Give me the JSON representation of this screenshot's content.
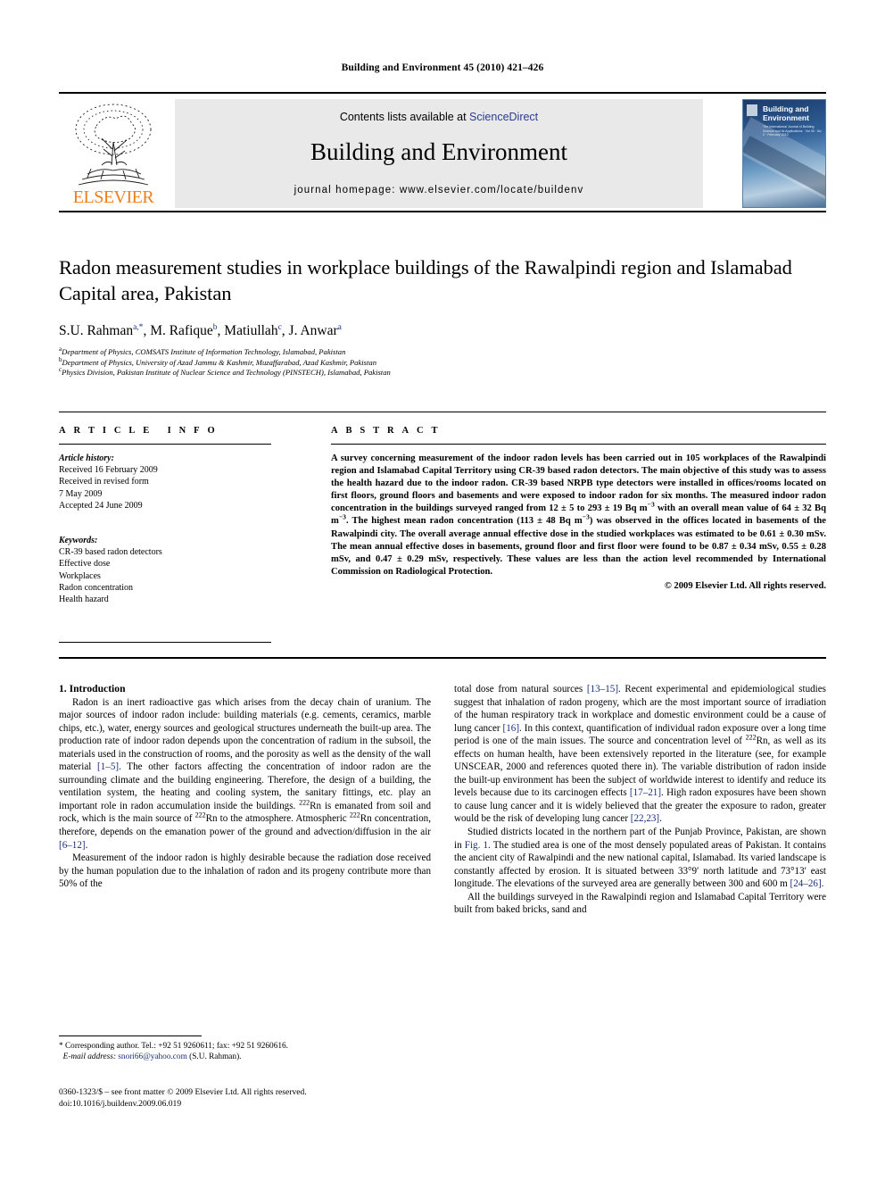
{
  "running_head": "Building and Environment 45 (2010) 421–426",
  "masthead": {
    "publisher_name": "ELSEVIER",
    "contents_prefix": "Contents lists available at ",
    "sciencedirect": "ScienceDirect",
    "journal_title": "Building and Environment",
    "homepage": "journal homepage: www.elsevier.com/locate/buildenv",
    "cover": {
      "title_line1": "Building and",
      "title_line2": "Environment",
      "subtitle": "The International Journal of Building Science and its Applications  ·  Vol 45  ·  No 2  ·  February 2010"
    }
  },
  "article": {
    "title": "Radon measurement studies in workplace buildings of the Rawalpindi region and Islamabad Capital area, Pakistan",
    "authors": "S.U. Rahman, M. Rafique, Matiullah, J. Anwar",
    "author_list": [
      {
        "name": "S.U. Rahman",
        "marks": "a,*"
      },
      {
        "name": "M. Rafique",
        "marks": "b"
      },
      {
        "name": "Matiullah",
        "marks": "c"
      },
      {
        "name": "J. Anwar",
        "marks": "a"
      }
    ],
    "affiliations": [
      {
        "mark": "a",
        "text": "Department of Physics, COMSATS Institute of Information Technology, Islamabad, Pakistan"
      },
      {
        "mark": "b",
        "text": "Department of Physics, University of Azad Jammu & Kashmir, Muzaffarabad, Azad Kashmir, Pakistan"
      },
      {
        "mark": "c",
        "text": "Physics Division, Pakistan Institute of Nuclear Science and Technology (PINSTECH), Islamabad, Pakistan"
      }
    ]
  },
  "article_info": {
    "heading": "ARTICLE INFO",
    "history_label": "Article history:",
    "history": [
      "Received 16 February 2009",
      "Received in revised form",
      "7 May 2009",
      "Accepted 24 June 2009"
    ],
    "keywords_label": "Keywords:",
    "keywords": [
      "CR-39 based radon detectors",
      "Effective dose",
      "Workplaces",
      "Radon concentration",
      "Health hazard"
    ]
  },
  "abstract": {
    "heading": "ABSTRACT",
    "text": "A survey concerning measurement of the indoor radon levels has been carried out in 105 workplaces of the Rawalpindi region and Islamabad Capital Territory using CR-39 based radon detectors. The main objective of this study was to assess the health hazard due to the indoor radon. CR-39 based NRPB type detectors were installed in offices/rooms located on first floors, ground floors and basements and were exposed to indoor radon for six months. The measured indoor radon concentration in the buildings surveyed ranged from 12 ± 5 to 293 ± 19 Bq m−3 with an overall mean value of 64 ± 32 Bq m−3. The highest mean radon concentration (113 ± 48 Bq m−3) was observed in the offices located in basements of the Rawalpindi city. The overall average annual effective dose in the studied workplaces was estimated to be 0.61 ± 0.30 mSv. The mean annual effective doses in basements, ground floor and first floor were found to be 0.87 ± 0.34 mSv, 0.55 ± 0.28 mSv, and 0.47 ± 0.29 mSv, respectively. These values are less than the action level recommended by International Commission on Radiological Protection.",
    "copyright": "© 2009 Elsevier Ltd. All rights reserved."
  },
  "body": {
    "section_heading": "1. Introduction",
    "left_paragraphs": [
      "Radon is an inert radioactive gas which arises from the decay chain of uranium. The major sources of indoor radon include: building materials (e.g. cements, ceramics, marble chips, etc.), water, energy sources and geological structures underneath the built-up area. The production rate of indoor radon depends upon the concentration of radium in the subsoil, the materials used in the construction of rooms, and the porosity as well as the density of the wall material [1–5]. The other factors affecting the concentration of indoor radon are the surrounding climate and the building engineering. Therefore, the design of a building, the ventilation system, the heating and cooling system, the sanitary fittings, etc. play an important role in radon accumulation inside the buildings. 222Rn is emanated from soil and rock, which is the main source of 222Rn to the atmosphere. Atmospheric 222Rn concentration, therefore, depends on the emanation power of the ground and advection/diffusion in the air [6–12].",
      "Measurement of the indoor radon is highly desirable because the radiation dose received by the human population due to the inhalation of radon and its progeny contribute more than 50% of the"
    ],
    "right_paragraphs": [
      "total dose from natural sources [13–15]. Recent experimental and epidemiological studies suggest that inhalation of radon progeny, which are the most important source of irradiation of the human respiratory track in workplace and domestic environment could be a cause of lung cancer [16]. In this context, quantification of individual radon exposure over a long time period is one of the main issues. The source and concentration level of 222Rn, as well as its effects on human health, have been extensively reported in the literature (see, for example UNSCEAR, 2000 and references quoted there in). The variable distribution of radon inside the built-up environment has been the subject of worldwide interest to identify and reduce its levels because due to its carcinogen effects [17–21]. High radon exposures have been shown to cause lung cancer and it is widely believed that the greater the exposure to radon, greater would be the risk of developing lung cancer [22,23].",
      "Studied districts located in the northern part of the Punjab Province, Pakistan, are shown in Fig. 1. The studied area is one of the most densely populated areas of Pakistan. It contains the ancient city of Rawalpindi and the new national capital, Islamabad. Its varied landscape is constantly affected by erosion. It is situated between 33°9′ north latitude and 73°13′ east longitude. The elevations of the surveyed area are generally between 300 and 600 m [24–26].",
      "All the buildings surveyed in the Rawalpindi region and Islamabad Capital Territory were built from baked bricks, sand and"
    ]
  },
  "footnote": {
    "corresponding": "* Corresponding author. Tel.: +92 51 9260611; fax: +92 51 9260616.",
    "email_label": "E-mail address:",
    "email": "snori66@yahoo.com",
    "email_suffix": "(S.U. Rahman)."
  },
  "imprint": {
    "line1": "0360-1323/$ – see front matter © 2009 Elsevier Ltd. All rights reserved.",
    "line2": "doi:10.1016/j.buildenv.2009.06.019"
  },
  "colors": {
    "link": "#1b2f7a",
    "elsevier_orange": "#f07f1a",
    "banner_gray": "#e9e9e9"
  }
}
